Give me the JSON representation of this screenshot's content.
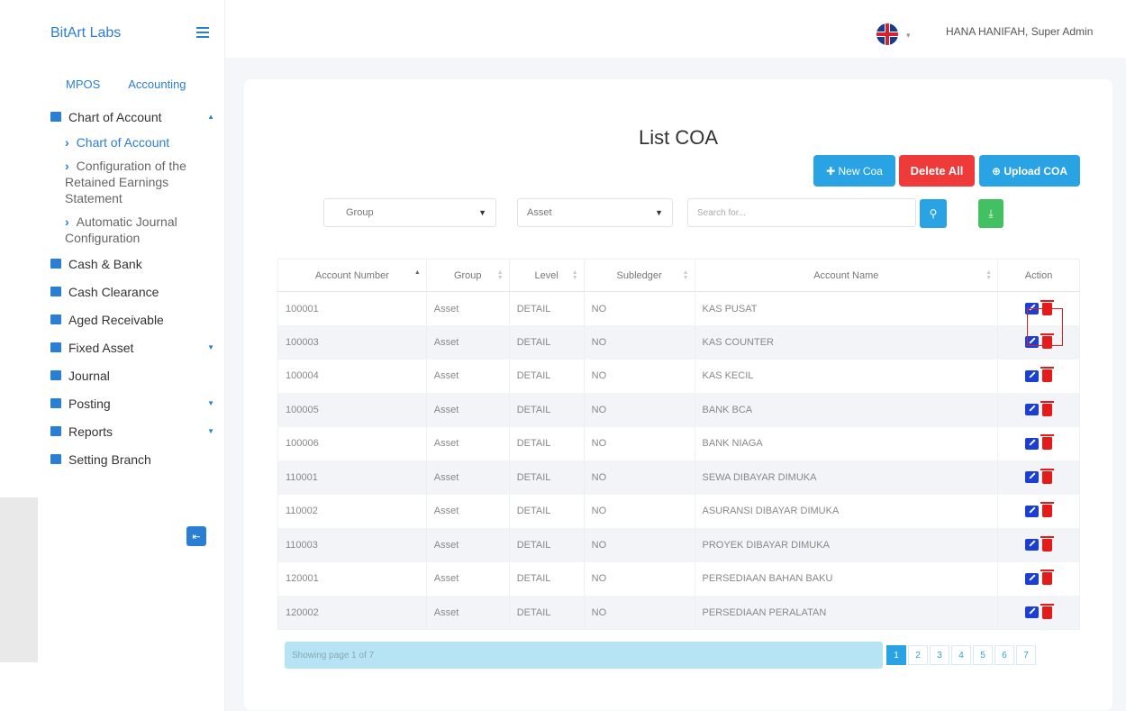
{
  "sidebar": {
    "brand": "BitArt Labs",
    "tabs": [
      "MPOS",
      "Accounting"
    ],
    "menu": {
      "chart_of_account": "Chart of Account",
      "sub_items": [
        "Chart of Account",
        "Configuration of the Retained Earnings Statement",
        "Automatic Journal Configuration"
      ],
      "cash_bank": "Cash & Bank",
      "cash_clearance": "Cash Clearance",
      "aged_receivable": "Aged Receivable",
      "fixed_asset": "Fixed Asset",
      "journal": "Journal",
      "posting": "Posting",
      "reports": "Reports",
      "setting_branch": "Setting Branch"
    }
  },
  "header": {
    "user": "HANA HANIFAH, Super Admin"
  },
  "main": {
    "title": "List COA",
    "buttons": {
      "new": "New Coa",
      "delete_all": "Delete All",
      "upload": "Upload COA"
    },
    "filters": {
      "group": "Group",
      "asset": "Asset",
      "search_placeholder": "Search for..."
    },
    "columns": [
      "Account Number",
      "Group",
      "Level",
      "Subledger",
      "Account Name",
      "Action"
    ],
    "rows": [
      [
        "100001",
        "Asset",
        "DETAIL",
        "NO",
        "KAS PUSAT"
      ],
      [
        "100003",
        "Asset",
        "DETAIL",
        "NO",
        "KAS COUNTER"
      ],
      [
        "100004",
        "Asset",
        "DETAIL",
        "NO",
        "KAS KECIL"
      ],
      [
        "100005",
        "Asset",
        "DETAIL",
        "NO",
        "BANK BCA"
      ],
      [
        "100006",
        "Asset",
        "DETAIL",
        "NO",
        "BANK NIAGA"
      ],
      [
        "110001",
        "Asset",
        "DETAIL",
        "NO",
        "SEWA DIBAYAR DIMUKA"
      ],
      [
        "110002",
        "Asset",
        "DETAIL",
        "NO",
        "ASURANSI DIBAYAR DIMUKA"
      ],
      [
        "110003",
        "Asset",
        "DETAIL",
        "NO",
        "PROYEK DIBAYAR DIMUKA"
      ],
      [
        "120001",
        "Asset",
        "DETAIL",
        "NO",
        "PERSEDIAAN BAHAN BAKU"
      ],
      [
        "120002",
        "Asset",
        "DETAIL",
        "NO",
        "PERSEDIAAN PERALATAN"
      ]
    ],
    "footer": "Showing page 1 of 7",
    "pages": [
      "1",
      "2",
      "3",
      "4",
      "5",
      "6",
      "7"
    ]
  }
}
